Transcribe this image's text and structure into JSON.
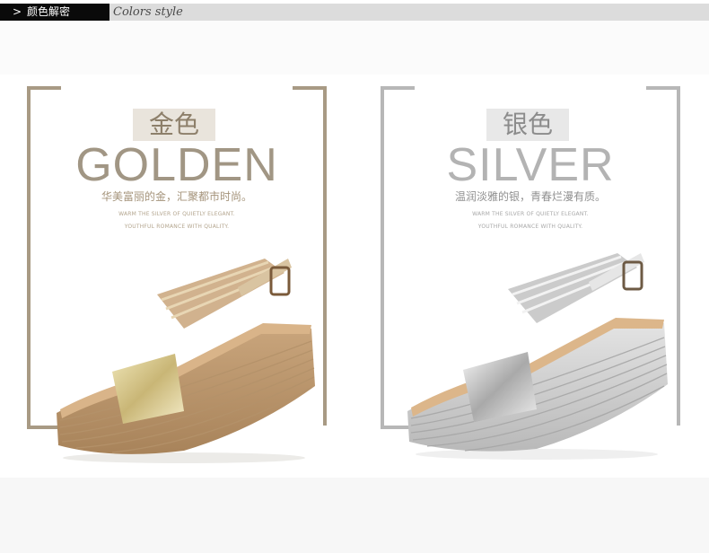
{
  "header": {
    "tag_label": "颜色解密",
    "tag_chevron": ">",
    "english_title": "Colors style"
  },
  "variants": [
    {
      "cn_name": "金色",
      "en_name": "GOLDEN",
      "tagline": "华美富丽的金，汇聚都市时尚。",
      "sub_line_1": "WARM THE SILVER OF QUIETLY ELEGANT.",
      "sub_line_2": "YOUTHFUL ROMANCE WITH QUALITY.",
      "accent": "#a89a84"
    },
    {
      "cn_name": "银色",
      "en_name": "SILVER",
      "tagline": "温润淡雅的银，青春烂漫有质。",
      "sub_line_1": "WARM THE SILVER OF QUIETLY ELEGANT.",
      "sub_line_2": "YOUTHFUL ROMANCE WITH QUALITY.",
      "accent": "#b7b7b7"
    }
  ],
  "images": [
    {
      "icon": "golden-wedge-sandal-image"
    },
    {
      "icon": "silver-wedge-sandal-image"
    }
  ]
}
